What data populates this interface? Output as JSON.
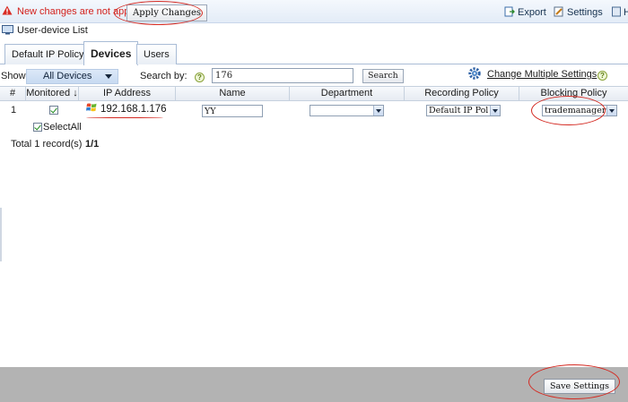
{
  "topbar": {
    "warning_text": "New changes are not applied",
    "apply_label": "Apply Changes",
    "export_label": "Export",
    "settings_label": "Settings",
    "help_label": "H"
  },
  "list_title": "User-device List",
  "tabs": [
    {
      "label": "Default IP Policy",
      "active": false
    },
    {
      "label": "Devices",
      "active": true
    },
    {
      "label": "Users",
      "active": false
    }
  ],
  "filter": {
    "show_label": "Show:",
    "show_value": "All Devices",
    "search_by_label": "Search by:",
    "search_value": "176",
    "search_button": "Search",
    "change_multiple": "Change Multiple Settings"
  },
  "table": {
    "headers": [
      "#",
      "Monitored ↓",
      "IP Address",
      "Name",
      "Department",
      "Recording Policy",
      "Blocking Policy"
    ],
    "rows": [
      {
        "num": "1",
        "monitored": true,
        "ip": "192.168.1.176",
        "name": "YY",
        "department": "",
        "recording_policy": "Default IP Pol",
        "blocking_policy": "trademanager"
      }
    ]
  },
  "selectall_label": "SelectAll",
  "total_label": "Total 1 record(s)",
  "pager": "1/1",
  "save_label": "Save Settings",
  "colors": {
    "warning": "#d3211c",
    "annotation": "#d42a22",
    "footer": "#b3b3b3",
    "header_bg": "#e3ecf7"
  }
}
